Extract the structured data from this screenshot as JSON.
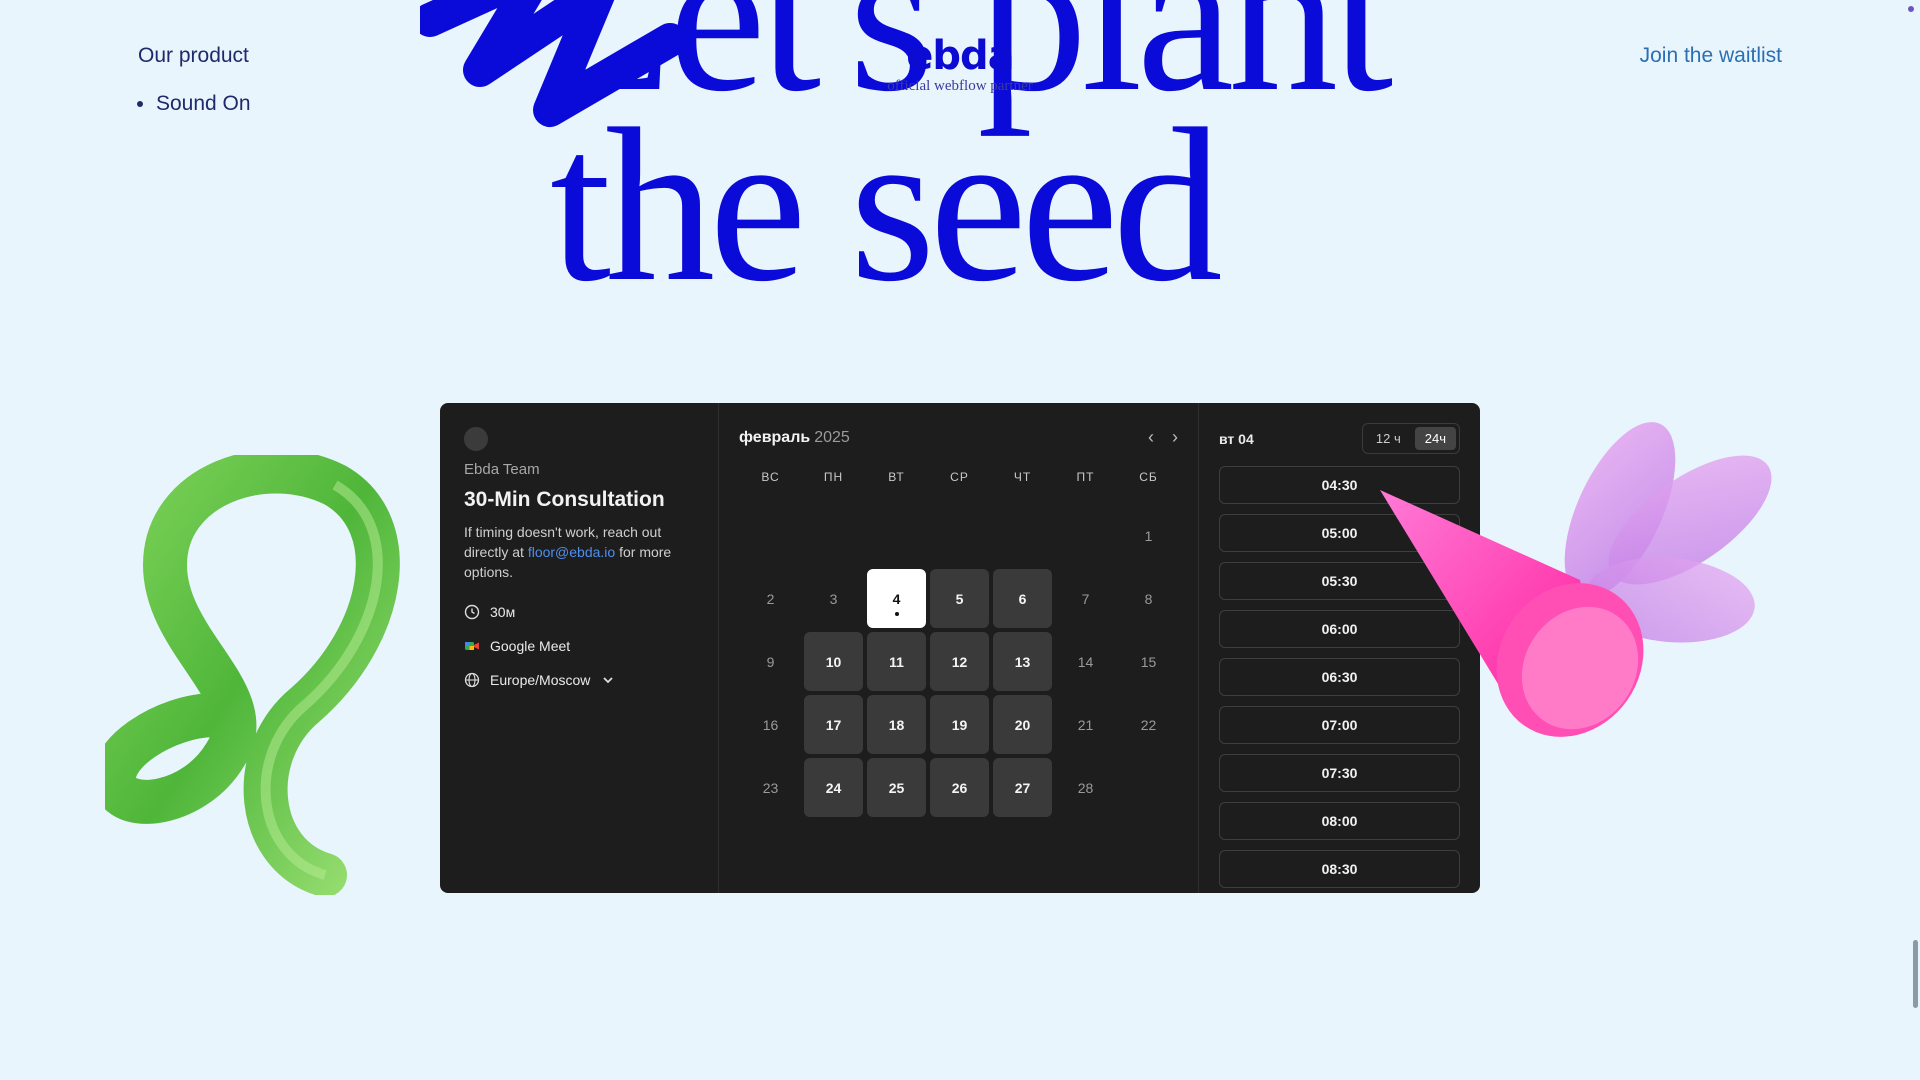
{
  "nav": {
    "product": "Our product",
    "item": "Sound On",
    "join": "Join the waitlist"
  },
  "brand": {
    "logo": "ebda",
    "subtitle": "official webflow partner"
  },
  "headline": {
    "line1": "Let's plant",
    "line2": "the seed"
  },
  "booking": {
    "team": "Ebda Team",
    "title": "30-Min Consultation",
    "desc_before": "If timing doesn't work, reach out directly at ",
    "email": "floor@ebda.io",
    "desc_after": " for more options.",
    "duration": "30м",
    "location": "Google Meet",
    "timezone": "Europe/Moscow"
  },
  "calendar": {
    "month": "февраль",
    "year": "2025",
    "weekdays": [
      "ВС",
      "ПН",
      "ВТ",
      "СР",
      "ЧТ",
      "ПТ",
      "СБ"
    ],
    "offset": 6,
    "days": [
      {
        "n": "1",
        "s": "off"
      },
      {
        "n": "2",
        "s": "off"
      },
      {
        "n": "3",
        "s": "off"
      },
      {
        "n": "4",
        "s": "sel"
      },
      {
        "n": "5",
        "s": "avail"
      },
      {
        "n": "6",
        "s": "avail"
      },
      {
        "n": "7",
        "s": "off"
      },
      {
        "n": "8",
        "s": "off"
      },
      {
        "n": "9",
        "s": "off"
      },
      {
        "n": "10",
        "s": "avail"
      },
      {
        "n": "11",
        "s": "avail"
      },
      {
        "n": "12",
        "s": "avail"
      },
      {
        "n": "13",
        "s": "avail"
      },
      {
        "n": "14",
        "s": "off"
      },
      {
        "n": "15",
        "s": "off"
      },
      {
        "n": "16",
        "s": "off"
      },
      {
        "n": "17",
        "s": "avail"
      },
      {
        "n": "18",
        "s": "avail"
      },
      {
        "n": "19",
        "s": "avail"
      },
      {
        "n": "20",
        "s": "avail"
      },
      {
        "n": "21",
        "s": "off"
      },
      {
        "n": "22",
        "s": "off"
      },
      {
        "n": "23",
        "s": "off"
      },
      {
        "n": "24",
        "s": "avail"
      },
      {
        "n": "25",
        "s": "avail"
      },
      {
        "n": "26",
        "s": "avail"
      },
      {
        "n": "27",
        "s": "avail"
      },
      {
        "n": "28",
        "s": "off"
      }
    ]
  },
  "times": {
    "date": "вт 04",
    "fmt12": "12 ч",
    "fmt24": "24ч",
    "slots": [
      "04:30",
      "05:00",
      "05:30",
      "06:00",
      "06:30",
      "07:00",
      "07:30",
      "08:00",
      "08:30"
    ]
  },
  "colors": {
    "page_bg": "#e9f5fd",
    "headline": "#0b0bd9",
    "widget_bg": "#1d1d1d",
    "link": "#4d8ff0"
  }
}
